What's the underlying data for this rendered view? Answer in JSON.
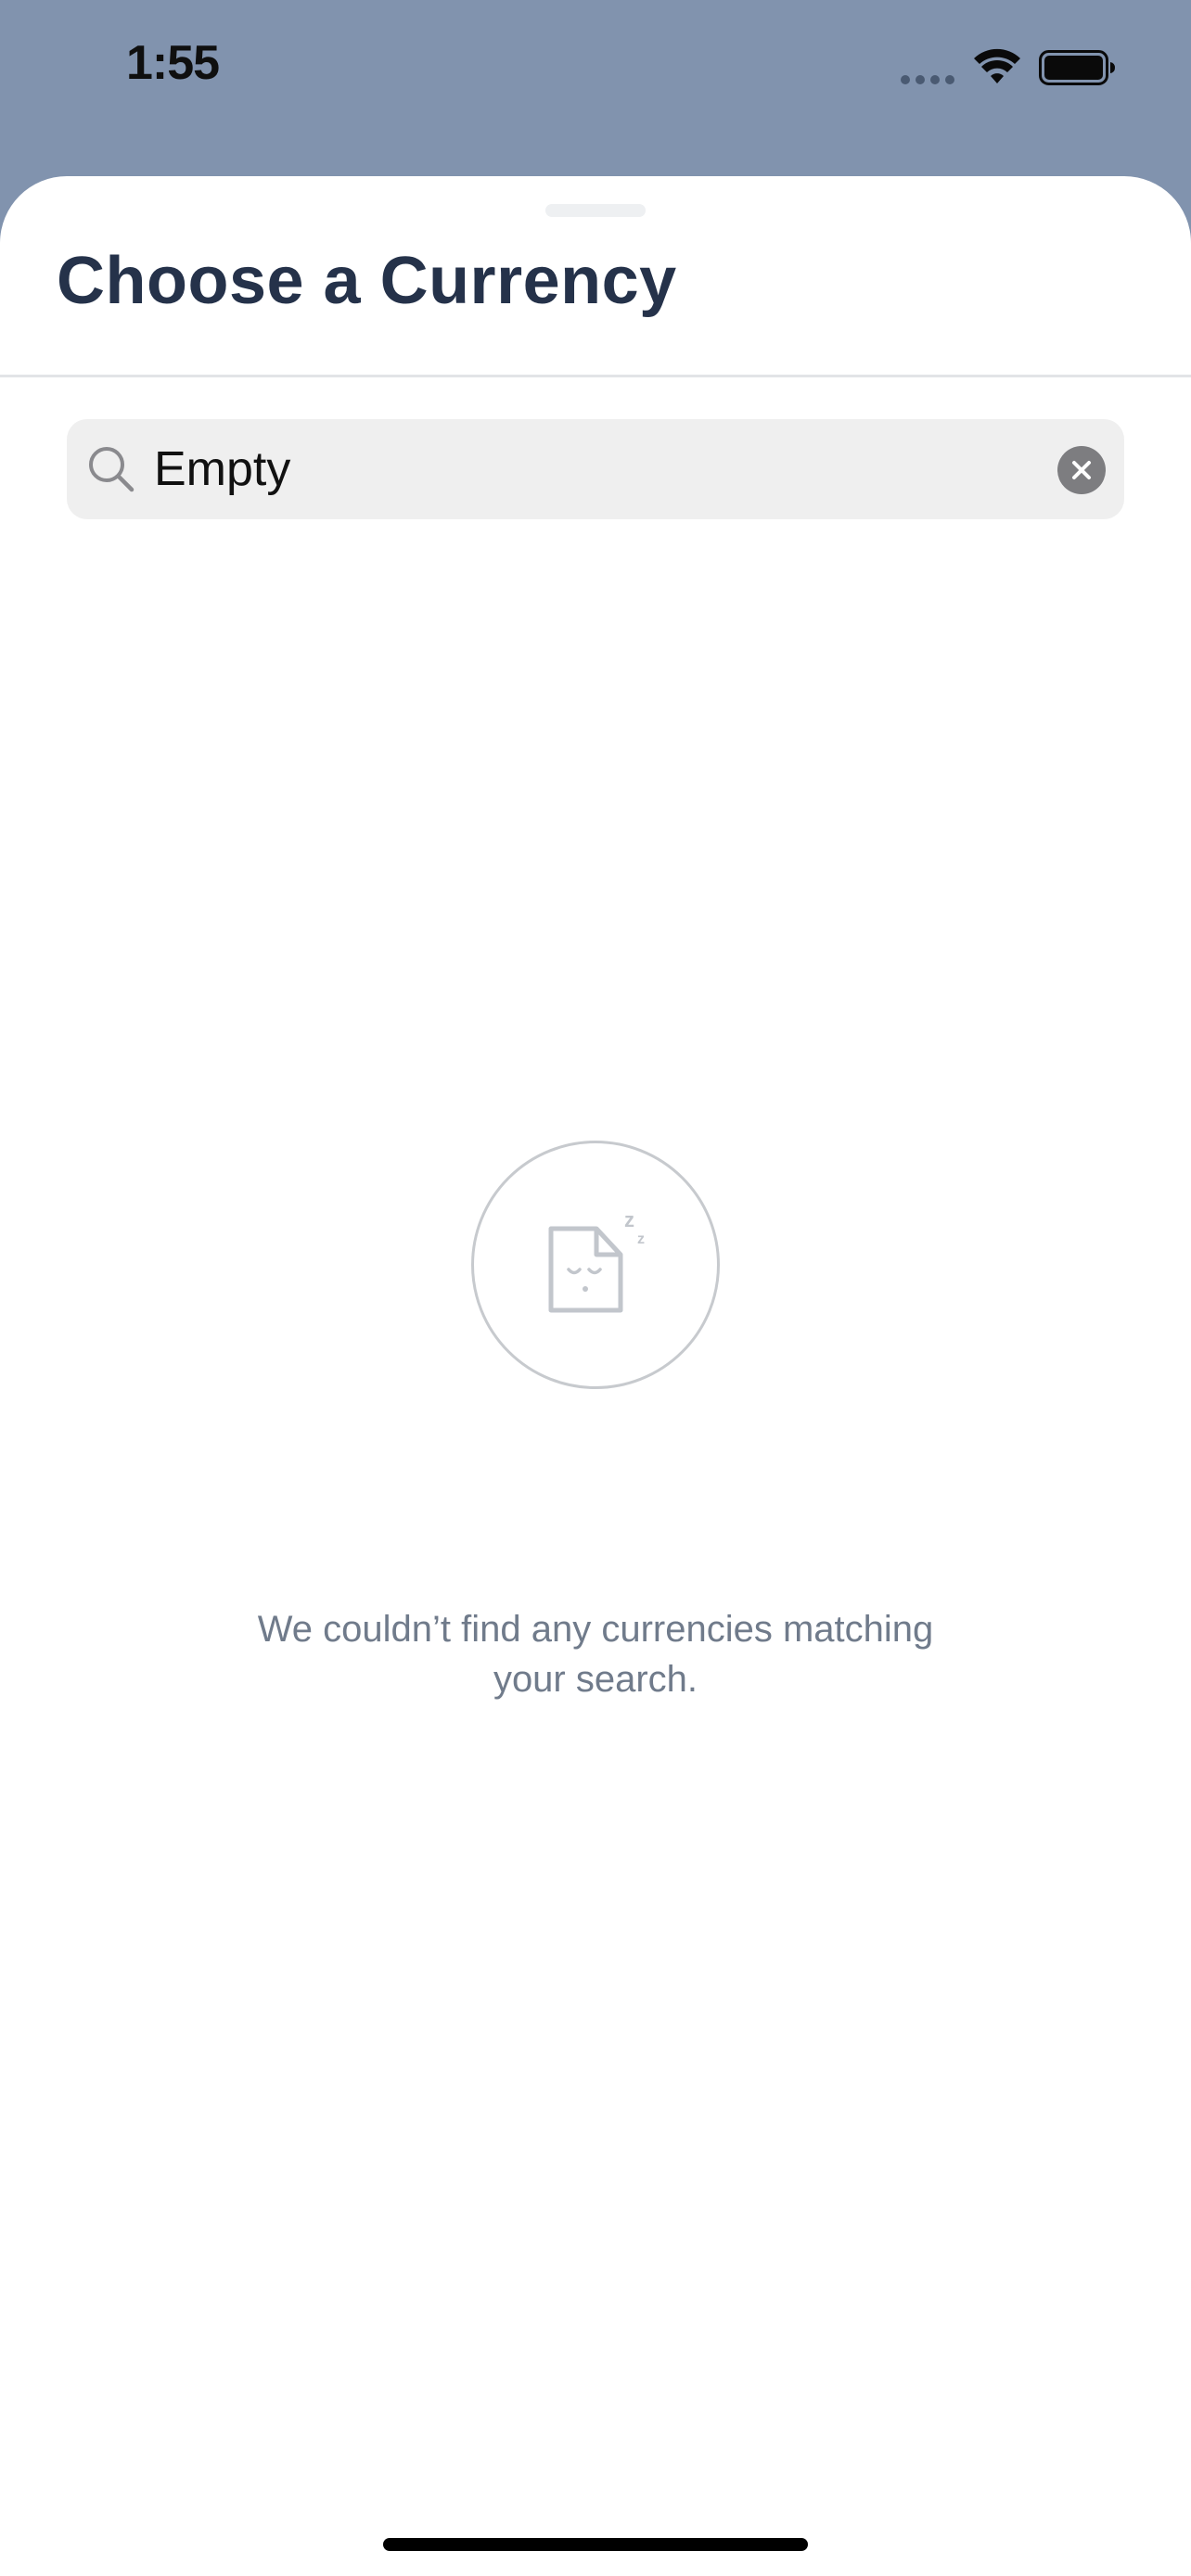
{
  "status_bar": {
    "time": "1:55"
  },
  "sheet": {
    "title": "Choose a Currency"
  },
  "search": {
    "value": "Empty",
    "icon": "search-icon",
    "clear_icon": "close-icon"
  },
  "empty_state": {
    "icon": "sleeping-document-icon",
    "message": "We couldn’t find any currencies matching your search."
  },
  "colors": {
    "backdrop": "#8193ae",
    "title": "#25324a",
    "message": "#707b8b",
    "search_bg": "#efefef"
  }
}
